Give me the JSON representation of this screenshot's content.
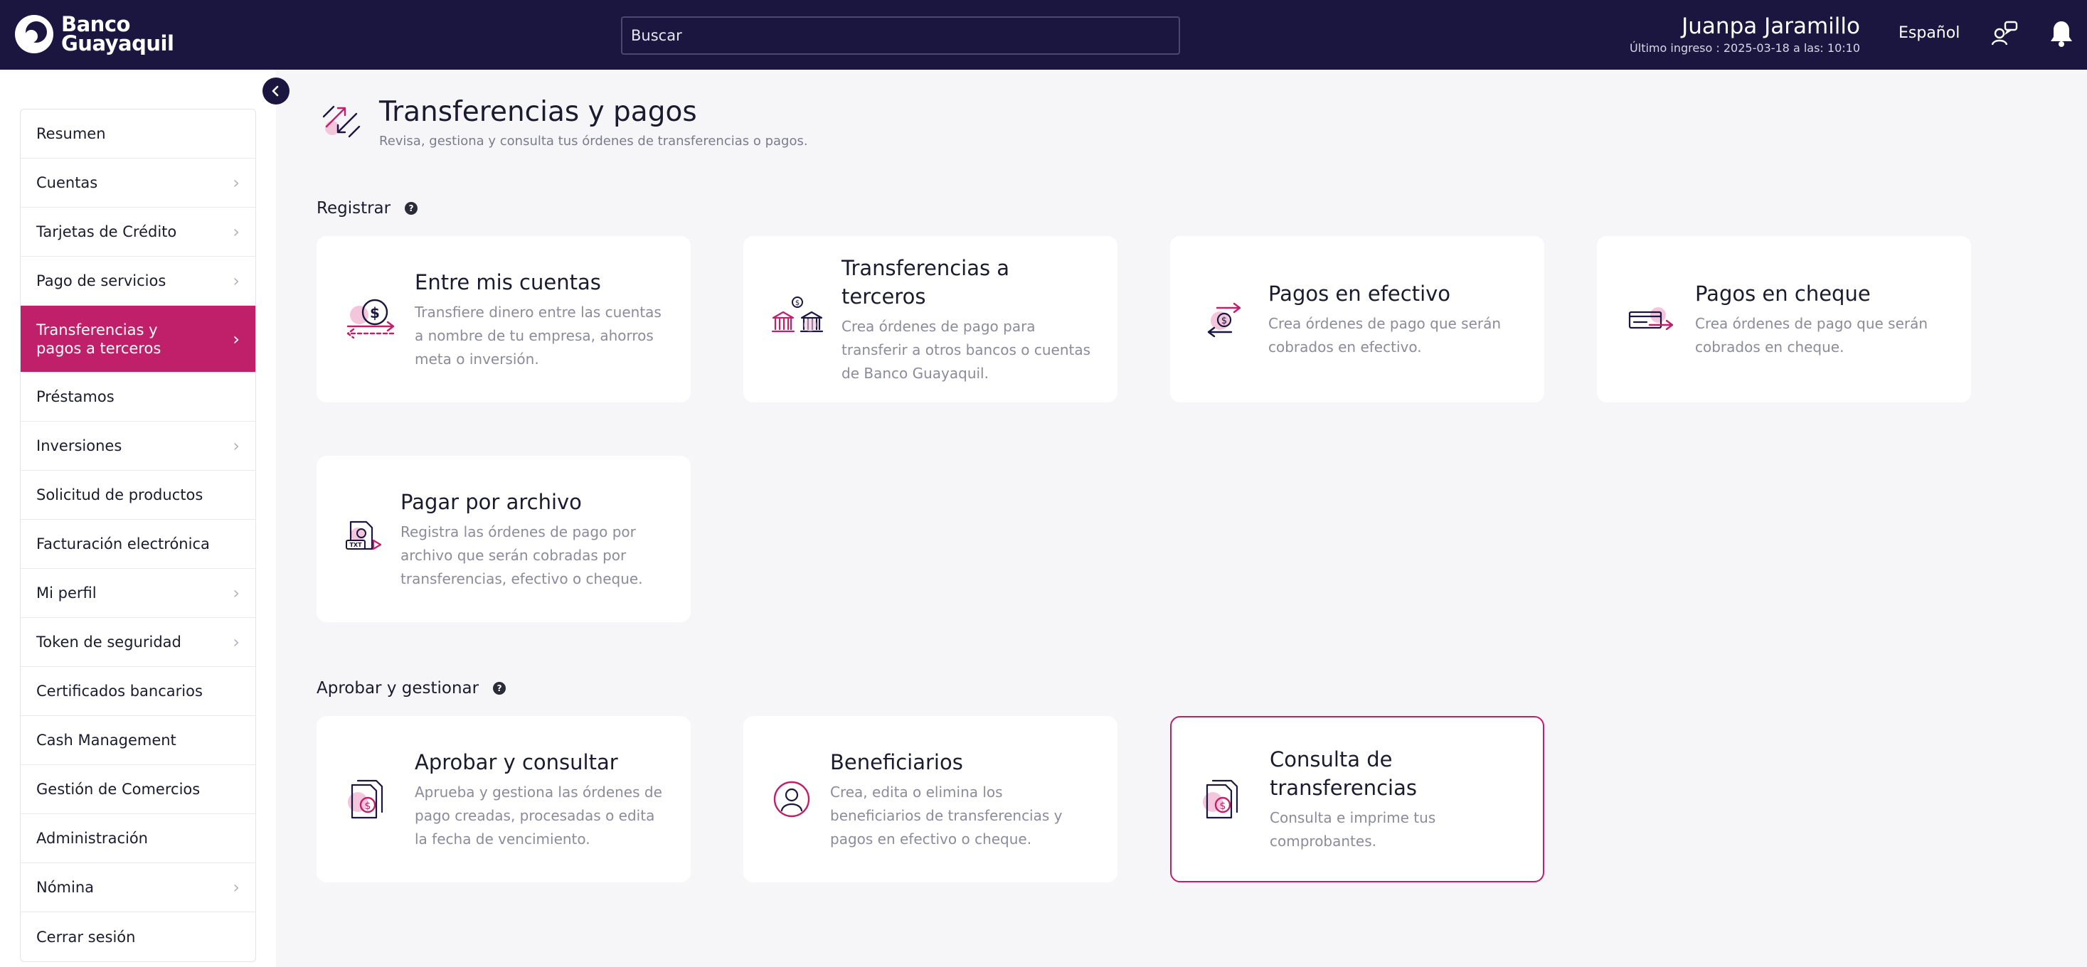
{
  "brand": {
    "line1": "Banco",
    "line2": "Guayaquil"
  },
  "search": {
    "placeholder": "Buscar"
  },
  "user": {
    "name": "Juanpa Jaramillo",
    "last_login": "Último ingreso : 2025-03-18 a las: 10:10"
  },
  "language": "Español",
  "colors": {
    "navy": "#1a1640",
    "accent": "#c0206a",
    "background": "#f6f6f9"
  },
  "sidebar": {
    "items": [
      {
        "label": "Resumen",
        "chevron": false
      },
      {
        "label": "Cuentas",
        "chevron": true
      },
      {
        "label": "Tarjetas de Crédito",
        "chevron": true
      },
      {
        "label": "Pago de servicios",
        "chevron": true
      },
      {
        "label": "Transferencias y pagos a terceros",
        "chevron": true,
        "active": true
      },
      {
        "label": "Préstamos",
        "chevron": false
      },
      {
        "label": "Inversiones",
        "chevron": true
      },
      {
        "label": "Solicitud de productos",
        "chevron": false
      },
      {
        "label": "Facturación electrónica",
        "chevron": false
      },
      {
        "label": "Mi perfil",
        "chevron": true
      },
      {
        "label": "Token de seguridad",
        "chevron": true
      },
      {
        "label": "Certificados bancarios",
        "chevron": false
      },
      {
        "label": "Cash Management",
        "chevron": false
      },
      {
        "label": "Gestión de Comercios",
        "chevron": false
      },
      {
        "label": "Administración",
        "chevron": false
      },
      {
        "label": "Nómina",
        "chevron": true
      },
      {
        "label": "Cerrar sesión",
        "chevron": false
      }
    ]
  },
  "page": {
    "title": "Transferencias y pagos",
    "subtitle": "Revisa, gestiona y consulta tus órdenes de transferencias o pagos."
  },
  "sections": {
    "registrar": {
      "title": "Registrar",
      "cards": [
        {
          "title": "Entre mis cuentas",
          "desc": "Transfiere dinero entre las cuentas a nombre de tu empresa, ahorros meta o inversión.",
          "icon": "transfer-accounts-icon"
        },
        {
          "title": "Transferencias a terceros",
          "desc": "Crea órdenes de pago para transferir a otros bancos o cuentas de Banco Guayaquil.",
          "icon": "bank-transfer-icon"
        },
        {
          "title": "Pagos en efectivo",
          "desc": "Crea órdenes de pago que serán cobrados en efectivo.",
          "icon": "cash-payment-icon"
        },
        {
          "title": "Pagos en cheque",
          "desc": "Crea órdenes de pago que serán cobrados en cheque.",
          "icon": "check-payment-icon"
        },
        {
          "title": "Pagar por archivo",
          "desc": "Registra las órdenes de pago por archivo que serán cobradas por transferencias, efectivo o cheque.",
          "icon": "file-payment-icon"
        }
      ]
    },
    "aprobar": {
      "title": "Aprobar y gestionar",
      "cards": [
        {
          "title": "Aprobar y consultar",
          "desc": "Aprueba y gestiona las órdenes de pago creadas, procesadas o edita la fecha de vencimiento.",
          "icon": "approve-documents-icon"
        },
        {
          "title": "Beneficiarios",
          "desc": "Crea, edita o elimina los beneficiarios de transferencias y pagos en efectivo o cheque.",
          "icon": "beneficiary-icon"
        },
        {
          "title": "Consulta de transferencias",
          "desc": "Consulta e imprime tus comprobantes.",
          "icon": "transfer-query-icon",
          "selected": true
        }
      ]
    }
  }
}
